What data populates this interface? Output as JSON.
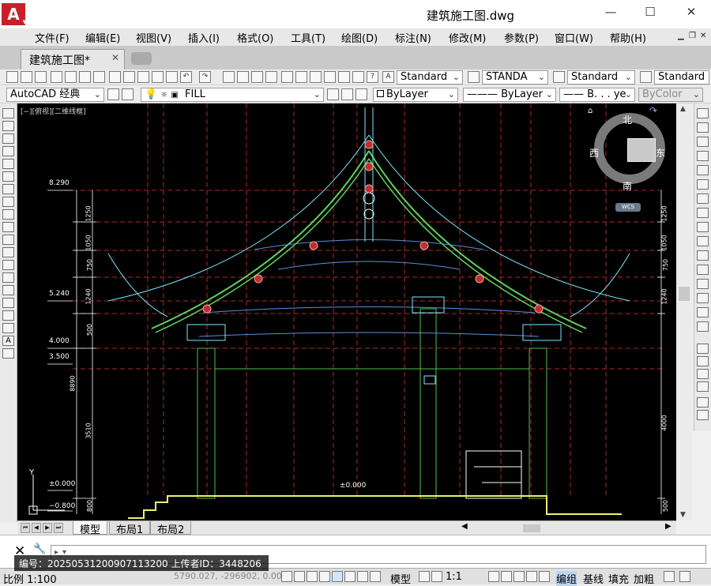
{
  "window": {
    "title": "建筑施工图.dwg"
  },
  "menu": [
    "文件(F)",
    "编辑(E)",
    "视图(V)",
    "插入(I)",
    "格式(O)",
    "工具(T)",
    "绘图(D)",
    "标注(N)",
    "修改(M)",
    "参数(P)",
    "窗口(W)",
    "帮助(H)"
  ],
  "tabs": {
    "document": "建筑施工图*"
  },
  "toolbar": {
    "text_style": "Standard",
    "dim_style": "STANDA",
    "table_style": "Standard",
    "mleader_style": "Standard",
    "workspace": "AutoCAD 经典",
    "layer": "FILL",
    "color": "ByLayer",
    "linetype": "ByLayer",
    "lineweight": "B. . . ye",
    "plotstyle": "ByColor"
  },
  "viewport": {
    "label": "[−][俯视][二维线框]"
  },
  "compass": {
    "north": "北",
    "south": "南",
    "east": "东",
    "west": "西",
    "wcs": "WCS"
  },
  "elevations": {
    "e1": "8.290",
    "e2": "5.240",
    "e3": "4.000",
    "e4": "3.500",
    "e5": "±0.000",
    "e6": "−0.800",
    "e7": "±0.000"
  },
  "dims_left": {
    "d1": "1250",
    "d2": "1050",
    "d3": "750",
    "d4": "1240",
    "d5": "500",
    "d6": "8890",
    "d7": "3510",
    "d8": "800"
  },
  "dims_right": {
    "d1": "1250",
    "d2": "1050",
    "d3": "750",
    "d4": "1240",
    "d5": "4000",
    "d6": "500"
  },
  "axis": {
    "y": "Y"
  },
  "layout_tabs": {
    "model": "模型",
    "layout1": "布局1",
    "layout2": "布局2"
  },
  "status": {
    "scale": "比例 1:100",
    "coords": "5790.027,  -296902,  0.0000",
    "model": "模型",
    "annot_scale": "1:1",
    "edit": "编组",
    "baseline": "基线",
    "fill": "填充",
    "weight": "加粗"
  },
  "watermark": {
    "text": "编号：20250531200907113200    上传者ID：3448206"
  },
  "colors": {
    "canvas": "#000000",
    "roof_green": "#5ed25e",
    "roof_cyan": "#7fe6ff",
    "grid_red": "#c03030",
    "column_green": "#4fc04f",
    "ground_yellow": "#f0f070"
  }
}
